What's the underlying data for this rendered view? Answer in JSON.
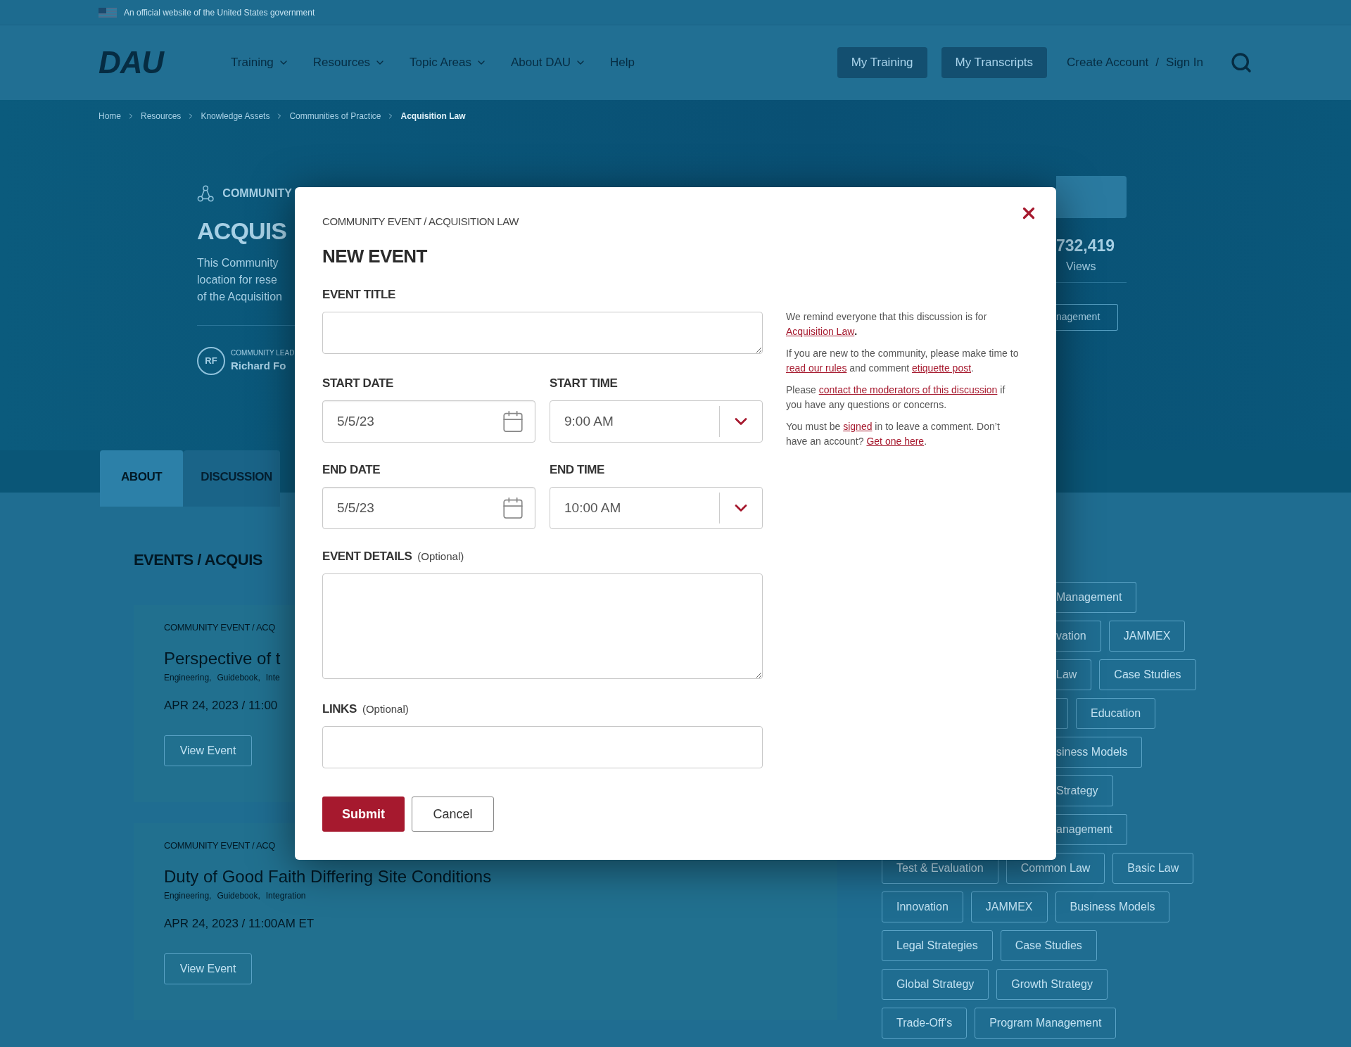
{
  "gov_banner": {
    "text": "An official website of the United States government"
  },
  "header": {
    "logo": "DAU",
    "nav": [
      {
        "label": "Training",
        "has_menu": true
      },
      {
        "label": "Resources",
        "has_menu": true
      },
      {
        "label": "Topic Areas",
        "has_menu": true
      },
      {
        "label": "About DAU",
        "has_menu": true
      },
      {
        "label": "Help",
        "has_menu": false
      }
    ],
    "buttons": [
      "My Training",
      "My Transcripts"
    ],
    "account_links": [
      "Create Account",
      "Sign In"
    ],
    "separator": "/"
  },
  "breadcrumb": [
    {
      "label": "Home",
      "current": false
    },
    {
      "label": "Resources",
      "current": false
    },
    {
      "label": "Knowledge Assets",
      "current": false
    },
    {
      "label": "Communities of Practice",
      "current": false
    },
    {
      "label": "Acquisition Law",
      "current": true
    }
  ],
  "hero": {
    "eyebrow": "COMMUNITY",
    "title": "ACQUIS",
    "description": [
      "This Community",
      "location for rese",
      "of the Acquisition"
    ],
    "lead_label": "COMMUNITY LEAD",
    "lead_initials": "RF",
    "lead_name": "Richard Fo",
    "views_count": "732,419",
    "views_label": "Views",
    "tag": "nagement"
  },
  "tabs": [
    {
      "label": "ABOUT",
      "selected": true
    },
    {
      "label": "DISCUSSION",
      "selected": false
    }
  ],
  "events": {
    "heading": "EVENTS / ACQUIS",
    "items": [
      {
        "category": "COMMUNITY EVENT / ACQ",
        "title": "Perspective of t",
        "tags": [
          "Engineering,",
          "Guidebook,",
          "Inte"
        ],
        "date": "APR 24, 2023 / 11:00",
        "action": "View Event"
      },
      {
        "category": "COMMUNITY EVENT / ACQ",
        "title": "Duty of Good Faith Differing Site Conditions",
        "tags": [
          "Engineering,",
          "Guidebook,",
          "Integration"
        ],
        "date": "APR 24, 2023 / 11:00AM ET",
        "action": "View Event"
      }
    ]
  },
  "tag_cloud": [
    {
      "partial": "Management"
    },
    {
      "partial": "vation",
      "tags": [
        "JAMMEX"
      ]
    },
    {
      "partial": "Law",
      "tags": [
        "Case Studies"
      ]
    },
    {
      "edge": true,
      "tags": [
        "Education"
      ]
    },
    {
      "partial": "siness Models"
    },
    {
      "partial": "Strategy"
    },
    {
      "partial": "anagement"
    },
    {
      "tags": [
        "Test & Evaluation",
        "Common Law",
        "Basic Law"
      ]
    },
    {
      "tags": [
        "Innovation",
        "JAMMEX",
        "Business Models"
      ]
    },
    {
      "tags": [
        "Legal Strategies",
        "Case Studies"
      ]
    },
    {
      "tags": [
        "Global Strategy",
        "Growth Strategy"
      ]
    },
    {
      "tags": [
        "Trade-Off’s",
        "Program Management"
      ]
    }
  ],
  "modal": {
    "breadcrumb": "COMMUNITY EVENT / ACQUISITION LAW",
    "title": "NEW EVENT",
    "event_title": {
      "label": "EVENT TITLE"
    },
    "start_date": {
      "label": "START DATE",
      "value": "5/5/23"
    },
    "start_time": {
      "label": "START TIME",
      "value": "9:00 AM"
    },
    "end_date": {
      "label": "END DATE",
      "value": "5/5/23"
    },
    "end_time": {
      "label": "END TIME",
      "value": "10:00 AM"
    },
    "details": {
      "label": "EVENT DETAILS",
      "hint": "(Optional)"
    },
    "links": {
      "label": "LINKS",
      "hint": "(Optional)"
    },
    "submit": "Submit",
    "cancel": "Cancel",
    "notice": [
      [
        {
          "kind": "text",
          "text": "We remind everyone that this discussion is for "
        },
        {
          "kind": "link",
          "text": "Acquisition Law"
        },
        {
          "kind": "strong",
          "text": "."
        }
      ],
      [
        {
          "kind": "text",
          "text": "If you are new to the community, please make time to "
        },
        {
          "kind": "link",
          "text": "read our rules"
        },
        {
          "kind": "text",
          "text": " and comment "
        },
        {
          "kind": "link",
          "text": "etiquette post"
        },
        {
          "kind": "text",
          "text": "."
        }
      ],
      [
        {
          "kind": "text",
          "text": "Please "
        },
        {
          "kind": "link",
          "text": "contact the moderators of this discussion"
        },
        {
          "kind": "text",
          "text": " if you have any questions or concerns."
        }
      ],
      [
        {
          "kind": "text",
          "text": "You must be "
        },
        {
          "kind": "link",
          "text": "signed"
        },
        {
          "kind": "text",
          "text": " in to leave a comment. Don’t have an account? "
        },
        {
          "kind": "link",
          "text": "Get one here"
        },
        {
          "kind": "text",
          "text": "."
        }
      ]
    ]
  }
}
